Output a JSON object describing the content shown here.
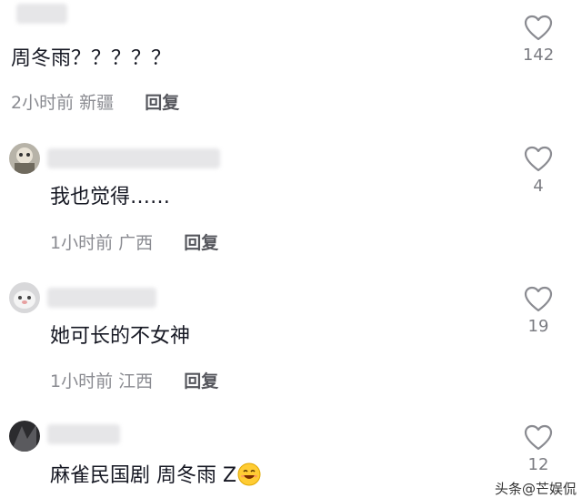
{
  "comments": [
    {
      "text": "周冬雨？？？？？",
      "time": "2小时前",
      "location": "新疆",
      "reply_label": "回复",
      "likes": "142"
    },
    {
      "text": "我也觉得……",
      "time": "1小时前",
      "location": "广西",
      "reply_label": "回复",
      "likes": "4"
    },
    {
      "text": "她可长的不女神",
      "time": "1小时前",
      "location": "江西",
      "reply_label": "回复",
      "likes": "19"
    },
    {
      "text": "麻雀民国剧 周冬雨 Z",
      "emoji": "grinning-face-emoji",
      "likes": "12"
    }
  ],
  "watermark": "头条@芒娱侃"
}
